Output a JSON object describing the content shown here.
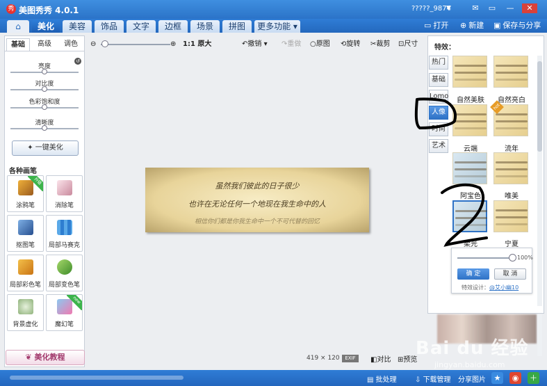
{
  "app": {
    "title": "美图秀秀 4.0.1",
    "logo_char": "秀",
    "user": "?????_9874"
  },
  "window_controls": [
    "✉",
    "▭",
    "—",
    "✕"
  ],
  "menu": {
    "home_icon": "home-icon",
    "tabs": [
      "美化",
      "美容",
      "饰品",
      "文字",
      "边框",
      "场景",
      "拼图",
      "更多功能 ▾"
    ],
    "active": "美化",
    "open_label": "打开",
    "new_label": "新建",
    "save_label": "保存与分享"
  },
  "left_panel": {
    "tabs": [
      "基础",
      "高级",
      "调色"
    ],
    "sliders": [
      {
        "label": "亮度",
        "value": 0.5
      },
      {
        "label": "对比度",
        "value": 0.5
      },
      {
        "label": "色彩饱和度",
        "value": 0.5
      },
      {
        "label": "清晰度",
        "value": 0.5
      }
    ],
    "one_key_label": "一键美化",
    "brushes_heading": "各种画笔",
    "brushes": [
      {
        "label": "涂鸦笔",
        "ribbon": "升级"
      },
      {
        "label": "消除笔"
      },
      {
        "label": "抠图笔"
      },
      {
        "label": "局部马赛克"
      },
      {
        "label": "局部彩色笔"
      },
      {
        "label": "局部变色笔"
      },
      {
        "label": "背景虚化"
      },
      {
        "label": "魔幻笔",
        "ribbon": "new"
      }
    ],
    "tutorial_label": "美化教程"
  },
  "canvas_toolbar": {
    "zoom_ratio_label": "1:1 原大",
    "undo_label": "撤销",
    "redo_label": "重做",
    "original_label": "原图",
    "rotate_label": "旋转",
    "crop_label": "裁剪",
    "size_label": "尺寸"
  },
  "photo": {
    "lines": [
      "虽然我们彼此的日子很少",
      "也许在无论任何一个地现在我生命中的人",
      "相信你们都是你我生命中一个不可代替的回忆"
    ]
  },
  "canvas_status": {
    "dimensions": "419 × 120",
    "exif_label": "EXIF",
    "compare_label": "对比",
    "preview_label": "预览"
  },
  "effects": {
    "title": "特效：",
    "categories": [
      "热门",
      "基础",
      "Lomo",
      "人像",
      "时尚",
      "艺术"
    ],
    "active_category": "人像",
    "thumbs": [
      {
        "label": "自然美肤"
      },
      {
        "label": "自然亮白"
      },
      {
        "label": "云端"
      },
      {
        "label": "流年",
        "badge": "hot"
      },
      {
        "label": "阿宝色"
      },
      {
        "label": "唯美"
      },
      {
        "label": "柔光"
      },
      {
        "label": "宁夏"
      }
    ],
    "popup": {
      "percent": "100%",
      "confirm_label": "确 定",
      "cancel_label": "取 消",
      "designer_prefix": "特效设计：",
      "designer_name": "@艾小幽10"
    }
  },
  "statusbar": {
    "batch_label": "批处理",
    "download_label": "下载管理",
    "share_label": "分享图片"
  },
  "watermark": {
    "text": "Bai du 经验",
    "url": "jingyan.baidu.com"
  },
  "colors": {
    "title_blue": "#2b73c8",
    "accent_blue": "#2e72c6",
    "annotation": "#000000"
  }
}
